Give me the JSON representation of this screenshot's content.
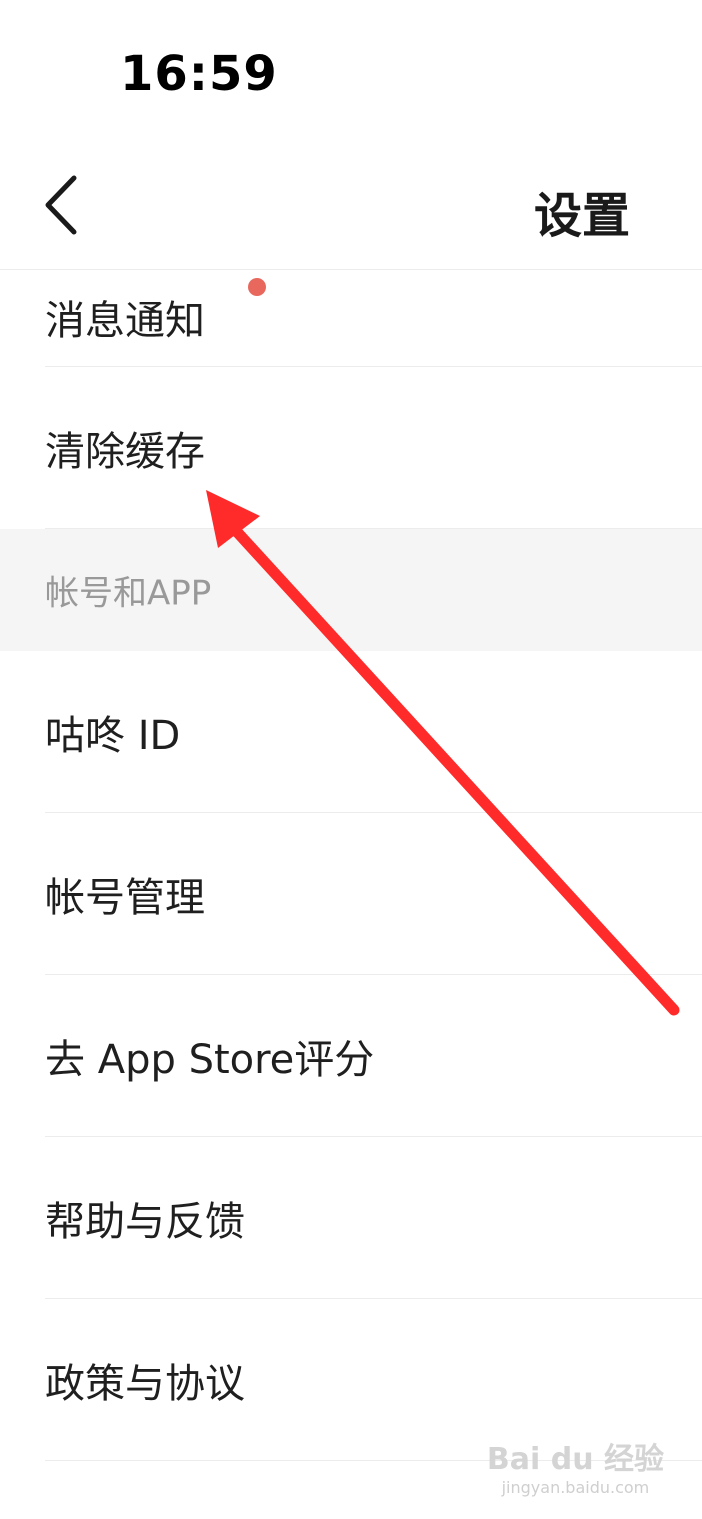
{
  "status_bar": {
    "time": "16:59"
  },
  "nav": {
    "title": "设置"
  },
  "rows_top": [
    {
      "label": "消息通知",
      "has_badge": true
    },
    {
      "label": "清除缓存"
    }
  ],
  "section": {
    "label": "帐号和APP"
  },
  "rows_bottom": [
    {
      "label": "咕咚 ID"
    },
    {
      "label": "帐号管理"
    },
    {
      "label": "去 App Store评分"
    },
    {
      "label": "帮助与反馈"
    },
    {
      "label": "政策与协议"
    }
  ],
  "colors": {
    "badge": "#e8685e",
    "annotation_arrow": "#ff2a2a",
    "section_bg": "#f5f5f5"
  },
  "watermark": {
    "logo": "Bai du 经验",
    "url": "jingyan.baidu.com"
  }
}
